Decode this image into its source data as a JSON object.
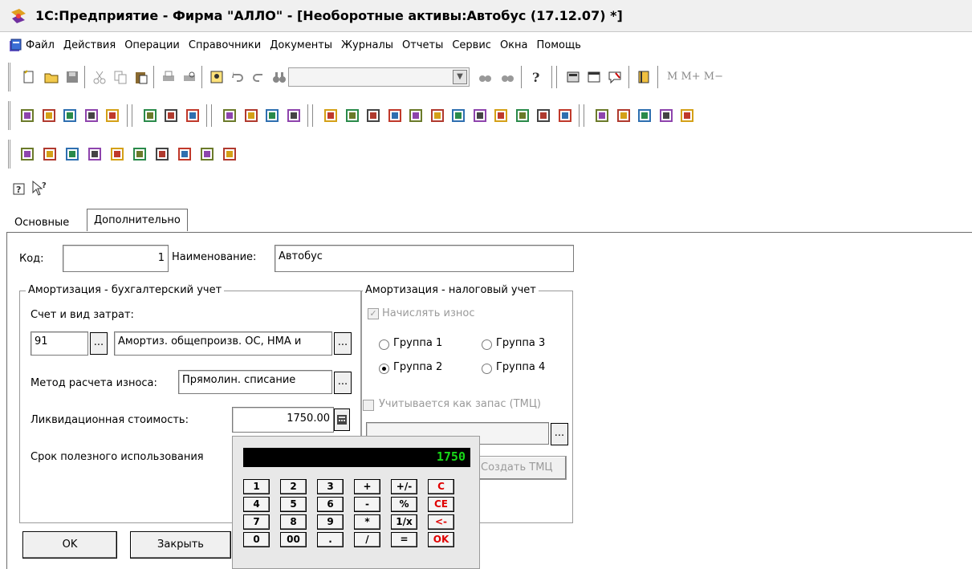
{
  "window": {
    "title": "1С:Предприятие - Фирма \"АЛЛО\" - [Необоротные активы:Автобус (17.12.07) *]"
  },
  "menu": [
    "Файл",
    "Действия",
    "Операции",
    "Справочники",
    "Документы",
    "Журналы",
    "Отчеты",
    "Сервис",
    "Окна",
    "Помощь"
  ],
  "toolbar": {
    "memory_buttons": "M  M+  M−"
  },
  "tabs": [
    "Основные",
    "Дополнительно"
  ],
  "active_tab": "Дополнительно",
  "form": {
    "code_label": "Код:",
    "code_value": "1",
    "name_label": "Наименование:",
    "name_value": "Автобус",
    "buh": {
      "legend": "Амортизация - бухгалтерский учет",
      "account_label": "Счет и вид затрат:",
      "account_value": "91",
      "cost_value": "Амортиз. общепроизв. ОС, НМА и",
      "method_label": "Метод расчета износа:",
      "method_value": "Прямолин. списание",
      "liquidation_label": "Ликвидационная стоимость:",
      "liquidation_value": "1750.00",
      "term_label": "Срок полезного использования"
    },
    "tax": {
      "legend": "Амортизация - налоговый учет",
      "accrue_label": "Начислять износ",
      "groups": [
        "Группа 1",
        "Группа 3",
        "Группа 2",
        "Группа 4"
      ],
      "selected_group": "Группа 2",
      "stock_label": "Учитывается как запас (ТМЦ)",
      "create_button": "Создать ТМЦ"
    }
  },
  "buttons": {
    "ok": "OK",
    "close": "Закрыть"
  },
  "calculator": {
    "display": "1750",
    "keys": [
      [
        "1",
        "2",
        "3",
        "+",
        "+/-",
        "C"
      ],
      [
        "4",
        "5",
        "6",
        "-",
        "%",
        "CE"
      ],
      [
        "7",
        "8",
        "9",
        "*",
        "1/x",
        "<-"
      ],
      [
        "0",
        "00",
        ".",
        "/",
        "=",
        "OK"
      ]
    ]
  }
}
